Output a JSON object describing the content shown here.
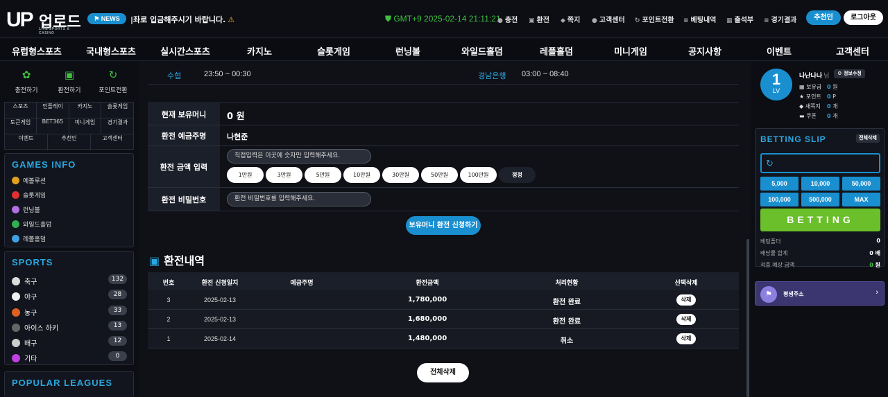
{
  "header": {
    "logo_up": "UP",
    "logo_ko": "업로드",
    "logo_sub": "LIVE SPORTS & CASINO",
    "news_label": "NEWS",
    "ticker": "|좌로 입금해주시기 바랍니다.",
    "clock": "GMT+9 2025-02-14 21:11:21",
    "menu": [
      {
        "icon": "●",
        "label": "충전"
      },
      {
        "icon": "▣",
        "label": "환전"
      },
      {
        "icon": "◆",
        "label": "쪽지"
      },
      {
        "icon": "●",
        "label": "고객센터"
      },
      {
        "icon": "↻",
        "label": "포인트전환"
      },
      {
        "icon": "≡",
        "label": "베팅내역"
      },
      {
        "icon": "▦",
        "label": "출석부"
      },
      {
        "icon": "≡",
        "label": "경기결과"
      }
    ],
    "recommend_label": "추천인",
    "logout_label": "로그아웃"
  },
  "nav": [
    "유럽형스포츠",
    "국내형스포츠",
    "실시간스포츠",
    "카지노",
    "슬롯게임",
    "런닝볼",
    "와일드홀덤",
    "레플홀덤",
    "미니게임",
    "공지사항",
    "이벤트",
    "고객센터"
  ],
  "left": {
    "quick": [
      {
        "icon": "✿",
        "label": "충전하기"
      },
      {
        "icon": "▣",
        "label": "환전하기"
      },
      {
        "icon": "↻",
        "label": "포인트전환"
      }
    ],
    "grid": [
      [
        "스포츠",
        "인플레이",
        "카지노",
        "슬롯게임"
      ],
      [
        "토큰게임",
        "BET365",
        "미니게임",
        "경기결과"
      ],
      [
        "이벤트",
        "추천인",
        "고객센터"
      ]
    ],
    "games_title": "GAMES INFO",
    "games": [
      {
        "label": "에볼루션",
        "color": "#e0a020"
      },
      {
        "label": "슬롯게임",
        "color": "#e03030"
      },
      {
        "label": "런닝볼",
        "color": "#b070e0"
      },
      {
        "label": "와일드홀덤",
        "color": "#30b050"
      },
      {
        "label": "레볼홀덤",
        "color": "#40a0e0"
      }
    ],
    "sports_title": "SPORTS",
    "sports": [
      {
        "label": "축구",
        "count": "132",
        "color": "#ddd"
      },
      {
        "label": "야구",
        "count": "28",
        "color": "#f0f0f0"
      },
      {
        "label": "농구",
        "count": "33",
        "color": "#e06020"
      },
      {
        "label": "아이스 하키",
        "count": "13",
        "color": "#666"
      },
      {
        "label": "배구",
        "count": "12",
        "color": "#ccc"
      },
      {
        "label": "기타",
        "count": "0",
        "color": "#c040e0"
      }
    ],
    "leagues_title": "POPULAR LEAGUES"
  },
  "main": {
    "bank_row": {
      "bank1": "수협",
      "time1": "23:50 ~ 00:30",
      "bank2": "경남은행",
      "time2": "03:00 ~ 08:40"
    },
    "form": {
      "balance_label": "현재 보유머니",
      "balance_value": "0 원",
      "depositor_label": "환전 예금주명",
      "depositor_value": "나현준",
      "amount_label": "환전 금액 입력",
      "amount_placeholder": "직접입력은 이곳에 숫자만 입력해주세요.",
      "amounts": [
        "1만원",
        "3만원",
        "5만원",
        "10만원",
        "30만원",
        "50만원",
        "100만원",
        "정정"
      ],
      "password_label": "환전 비밀번호",
      "password_placeholder": "환전 비밀번호를 입력해주세요.",
      "apply_label": "보유머니 환전 신청하기"
    },
    "history_title": "환전내역",
    "table_headers": [
      "번호",
      "환전 신청일지",
      "예금주명",
      "환전금액",
      "처리현황",
      "선택삭제"
    ],
    "rows": [
      {
        "no": "3",
        "date": "2025-02-13",
        "name": "",
        "amount": "1,780,000",
        "status": "환전 완료",
        "del": "삭제"
      },
      {
        "no": "2",
        "date": "2025-02-13",
        "name": "",
        "amount": "1,680,000",
        "status": "환전 완료",
        "del": "삭제"
      },
      {
        "no": "1",
        "date": "2025-02-14",
        "name": "",
        "amount": "1,480,000",
        "status": "취소",
        "del": "삭제"
      }
    ],
    "delete_all_label": "전체삭제"
  },
  "right": {
    "level_num": "1",
    "level_lv": "LV",
    "username": "나난나나",
    "nim": "님",
    "info_edit": "⚙ 정보수정",
    "stats": [
      {
        "icon": "▦",
        "label": "보유금",
        "value": "0",
        "unit": "원"
      },
      {
        "icon": "★",
        "label": "포인트",
        "value": "0",
        "unit": "P"
      },
      {
        "icon": "◆",
        "label": "새쪽지",
        "value": "0",
        "unit": "개"
      },
      {
        "icon": "▬",
        "label": "쿠폰",
        "value": "0",
        "unit": "개"
      }
    ],
    "slip_title": "BETTING SLIP",
    "slip_clear": "전체삭제",
    "chips": [
      "5,000",
      "10,000",
      "50,000",
      "100,000",
      "500,000",
      "MAX"
    ],
    "bet_label": "BETTING",
    "slip_lines": [
      {
        "label": "베팅폴더",
        "value": "0",
        "unit": ""
      },
      {
        "label": "배당률 합계",
        "value": "0",
        "unit": "배"
      },
      {
        "label": "적중 예상 금액",
        "value": "0",
        "unit": "원"
      }
    ],
    "perm_label": "평생주소",
    "accent": "#1a8fd0"
  }
}
